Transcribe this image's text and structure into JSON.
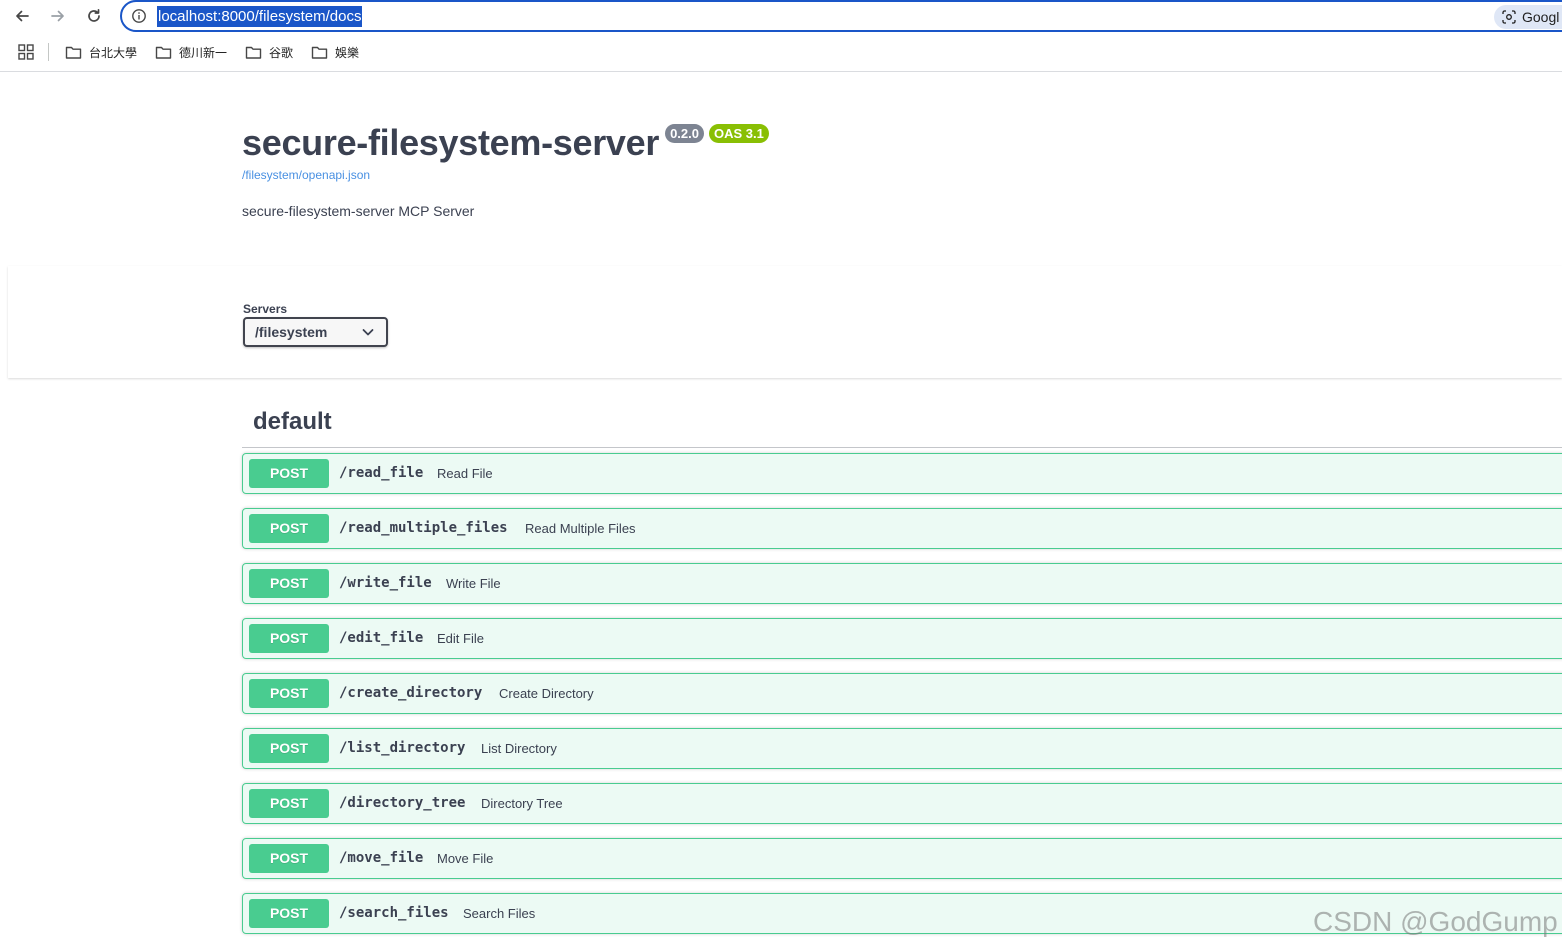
{
  "browser": {
    "url": "localhost:8000/filesystem/docs",
    "lens_chip_label": "Googl",
    "bookmarks": [
      {
        "label": "台北大學"
      },
      {
        "label": "德川新一"
      },
      {
        "label": "谷歌"
      },
      {
        "label": "娛樂"
      }
    ]
  },
  "info": {
    "title": "secure-filesystem-server",
    "version_badge": "0.2.0",
    "oas_badge": "OAS 3.1",
    "spec_link": "/filesystem/openapi.json",
    "description": "secure-filesystem-server MCP Server"
  },
  "servers": {
    "label": "Servers",
    "selected": "/filesystem"
  },
  "tag": {
    "name": "default",
    "operations": [
      {
        "method": "POST",
        "path": "/read_file",
        "summary": "Read File"
      },
      {
        "method": "POST",
        "path": "/read_multiple_files",
        "summary": "Read Multiple Files"
      },
      {
        "method": "POST",
        "path": "/write_file",
        "summary": "Write File"
      },
      {
        "method": "POST",
        "path": "/edit_file",
        "summary": "Edit File"
      },
      {
        "method": "POST",
        "path": "/create_directory",
        "summary": "Create Directory"
      },
      {
        "method": "POST",
        "path": "/list_directory",
        "summary": "List Directory"
      },
      {
        "method": "POST",
        "path": "/directory_tree",
        "summary": "Directory Tree"
      },
      {
        "method": "POST",
        "path": "/move_file",
        "summary": "Move File"
      },
      {
        "method": "POST",
        "path": "/search_files",
        "summary": "Search Files"
      }
    ]
  },
  "colors": {
    "post": "#49cc90",
    "accent": "#1a56c8"
  },
  "watermark": "CSDN @GodGump"
}
